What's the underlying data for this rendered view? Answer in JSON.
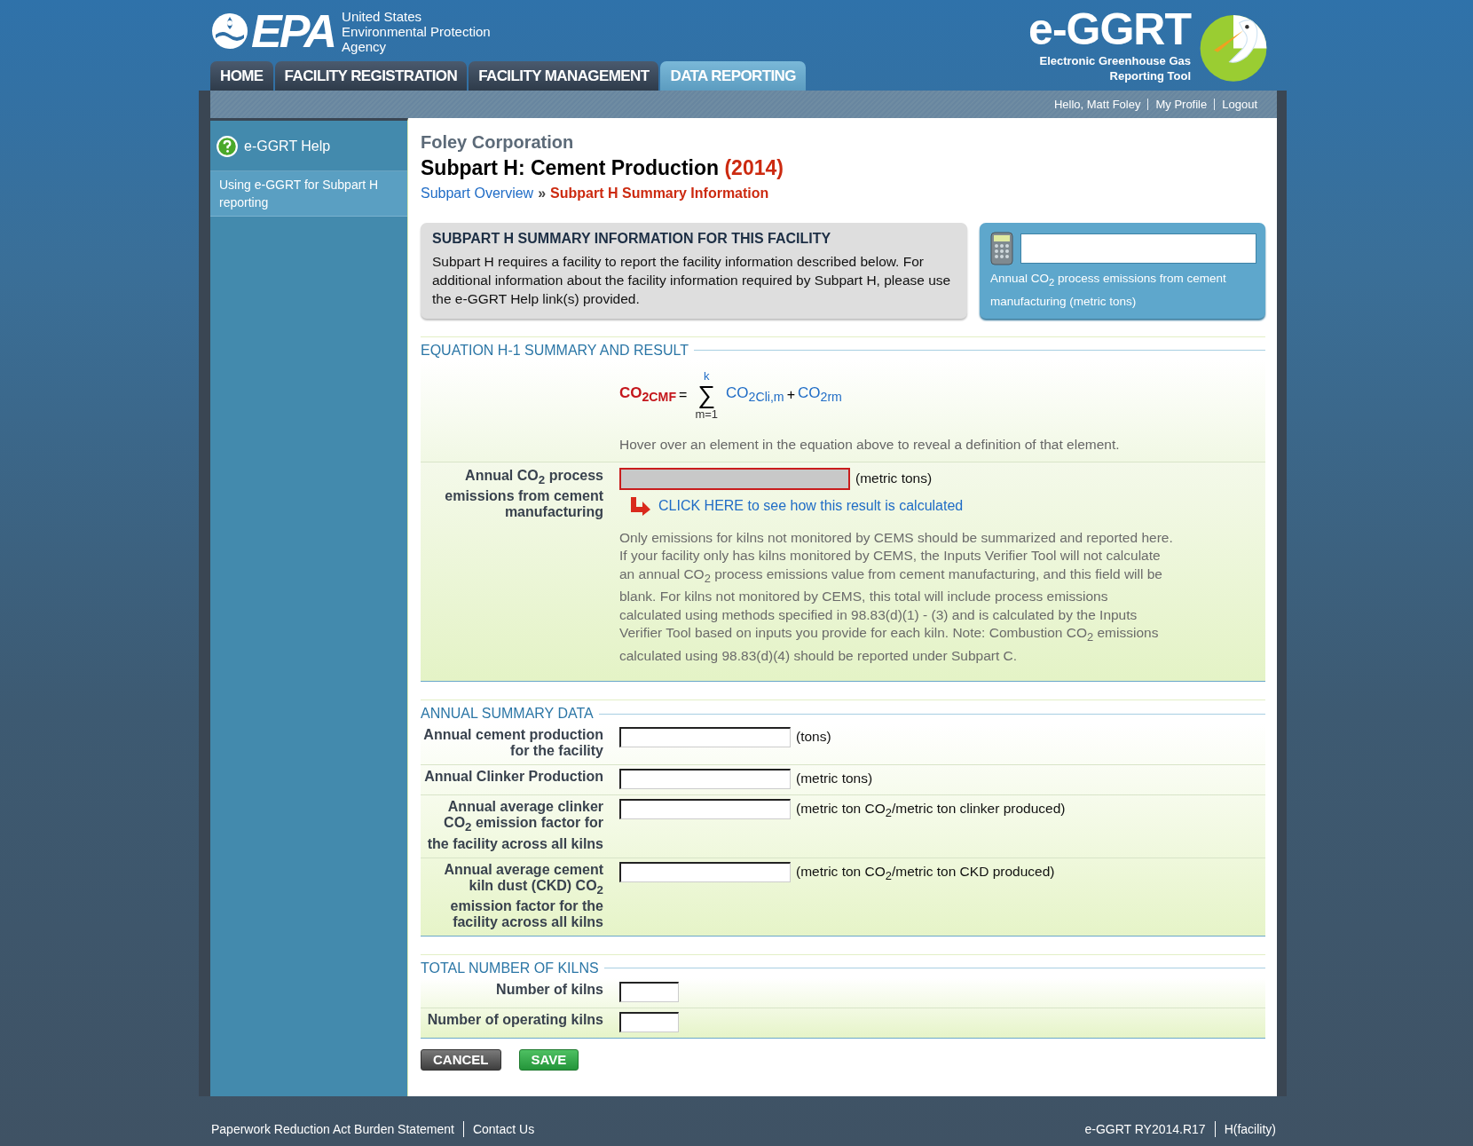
{
  "header": {
    "wordmark": "EPA",
    "agency_lines": [
      "United States",
      "Environmental Protection",
      "Agency"
    ],
    "tool_name": "e-GGRT",
    "tool_subtitle_lines": [
      "Electronic Greenhouse Gas",
      "Reporting Tool"
    ]
  },
  "tabs": [
    {
      "label": "HOME",
      "selected": false
    },
    {
      "label": "FACILITY REGISTRATION",
      "selected": false
    },
    {
      "label": "FACILITY MANAGEMENT",
      "selected": false
    },
    {
      "label": "DATA REPORTING",
      "selected": true
    }
  ],
  "user_bar": {
    "greeting": "Hello, Matt Foley",
    "links": [
      "My Profile",
      "Logout"
    ]
  },
  "sidebar": {
    "help_title": "e-GGRT Help",
    "items": [
      {
        "label": "Using e-GGRT for Subpart H reporting"
      }
    ]
  },
  "page": {
    "company": "Foley Corporation",
    "title": "Subpart H: Cement Production",
    "year": "(2014)",
    "breadcrumb_separator": "»",
    "breadcrumb": [
      {
        "label": "Subpart Overview",
        "selected": false
      },
      {
        "label": "Subpart H Summary Information",
        "selected": true
      }
    ]
  },
  "info_box": {
    "heading": "SUBPART H SUMMARY INFORMATION FOR THIS FACILITY",
    "text": "Subpart H requires a facility to report the facility information described below. For additional information about the facility information required by Subpart H, please use the e-GGRT Help link(s) provided."
  },
  "result_box": {
    "caption": "Annual CO$_{2}$ process emissions from cement manufacturing (metric tons)"
  },
  "equation_section": {
    "heading": "EQUATION H-1 SUMMARY AND RESULT",
    "equation": {
      "lhs": "CO$_{2CMF}$",
      "equals": "=",
      "sigma": "∑",
      "upper": "k",
      "lower": "m=1",
      "terms": [
        "CO$_{2Cli,m}$",
        "CO$_{2rm}$"
      ],
      "plus": "+"
    },
    "hint": "Hover over an element in the equation above to reveal a definition of that element.",
    "result_row": {
      "label": "Annual CO$_{2}$ process emissions from cement manufacturing",
      "unit": "(metric tons)",
      "link": "CLICK HERE to see how this result is calculated",
      "note": "Only emissions for kilns not monitored by CEMS should be summarized and reported here. If your facility only has kilns monitored by CEMS, the Inputs Verifier Tool will not calculate an annual CO$_{2}$ process emissions value from cement manufacturing, and this field will be blank. For kilns not monitored by CEMS, this total will include process emissions calculated using methods specified in 98.83(d)(1) - (3) and is calculated by the Inputs Verifier Tool based on inputs you provide for each kiln. Note: Combustion CO$_{2}$ emissions calculated using 98.83(d)(4) should be reported under Subpart C."
    }
  },
  "annual_summary": {
    "heading": "ANNUAL SUMMARY DATA",
    "rows": [
      {
        "label": "Annual cement production for the facility",
        "unit": "(tons)"
      },
      {
        "label": "Annual Clinker Production",
        "unit": "(metric tons)"
      },
      {
        "label": "Annual average clinker CO$_{2}$ emission factor for the facility across all kilns",
        "unit": "(metric ton CO$_{2}$/metric ton clinker produced)"
      },
      {
        "label": "Annual average cement kiln dust (CKD) CO$_{2}$ emission factor for the facility across all kilns",
        "unit": "(metric ton CO$_{2}$/metric ton CKD produced)"
      }
    ]
  },
  "kilns": {
    "heading": "TOTAL NUMBER OF KILNS",
    "rows": [
      {
        "label": "Number of kilns"
      },
      {
        "label": "Number of operating kilns"
      }
    ]
  },
  "buttons": [
    {
      "label": "CANCEL",
      "kind": "cancel"
    },
    {
      "label": "SAVE",
      "kind": "save"
    }
  ],
  "footer": {
    "left": [
      "Paperwork Reduction Act Burden Statement",
      "Contact Us"
    ],
    "right": [
      "e-GGRT RY2014.R17",
      "H(facility)"
    ]
  }
}
